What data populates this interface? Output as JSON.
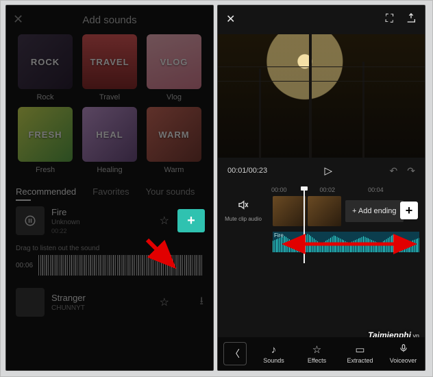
{
  "left": {
    "title": "Add sounds",
    "categories": [
      {
        "name": "Rock",
        "thumb_text": "ROCK",
        "cls": "tRock"
      },
      {
        "name": "Travel",
        "thumb_text": "TRAVEL",
        "cls": "tTravel"
      },
      {
        "name": "Vlog",
        "thumb_text": "VLOG",
        "cls": "tVlog"
      },
      {
        "name": "Fresh",
        "thumb_text": "FRESH",
        "cls": "tFresh"
      },
      {
        "name": "Healing",
        "thumb_text": "HEAL",
        "cls": "tHeal"
      },
      {
        "name": "Warm",
        "thumb_text": "WARM",
        "cls": "tWarm"
      }
    ],
    "tabs": {
      "recommended": "Recommended",
      "favorites": "Favorites",
      "your_sounds": "Your sounds"
    },
    "tracks": [
      {
        "title": "Fire",
        "artist": "Unknown",
        "duration": "00:22"
      },
      {
        "title": "Stranger",
        "artist": "CHUNNYT",
        "duration": ""
      }
    ],
    "drag_hint": "Drag to listen out the sound",
    "wave_time": "00:06"
  },
  "right": {
    "time": "00:01/00:23",
    "ruler": [
      "00:00",
      "00:02",
      "00:04"
    ],
    "mute_label": "Mute clip audio",
    "add_ending": "+ Add ending",
    "audio_clip": "Fire",
    "tools": {
      "sounds": "Sounds",
      "effects": "Effects",
      "extracted": "Extracted",
      "voiceover": "Voiceover"
    },
    "watermark": "Taimienphi",
    "watermark_suffix": ".vn"
  }
}
